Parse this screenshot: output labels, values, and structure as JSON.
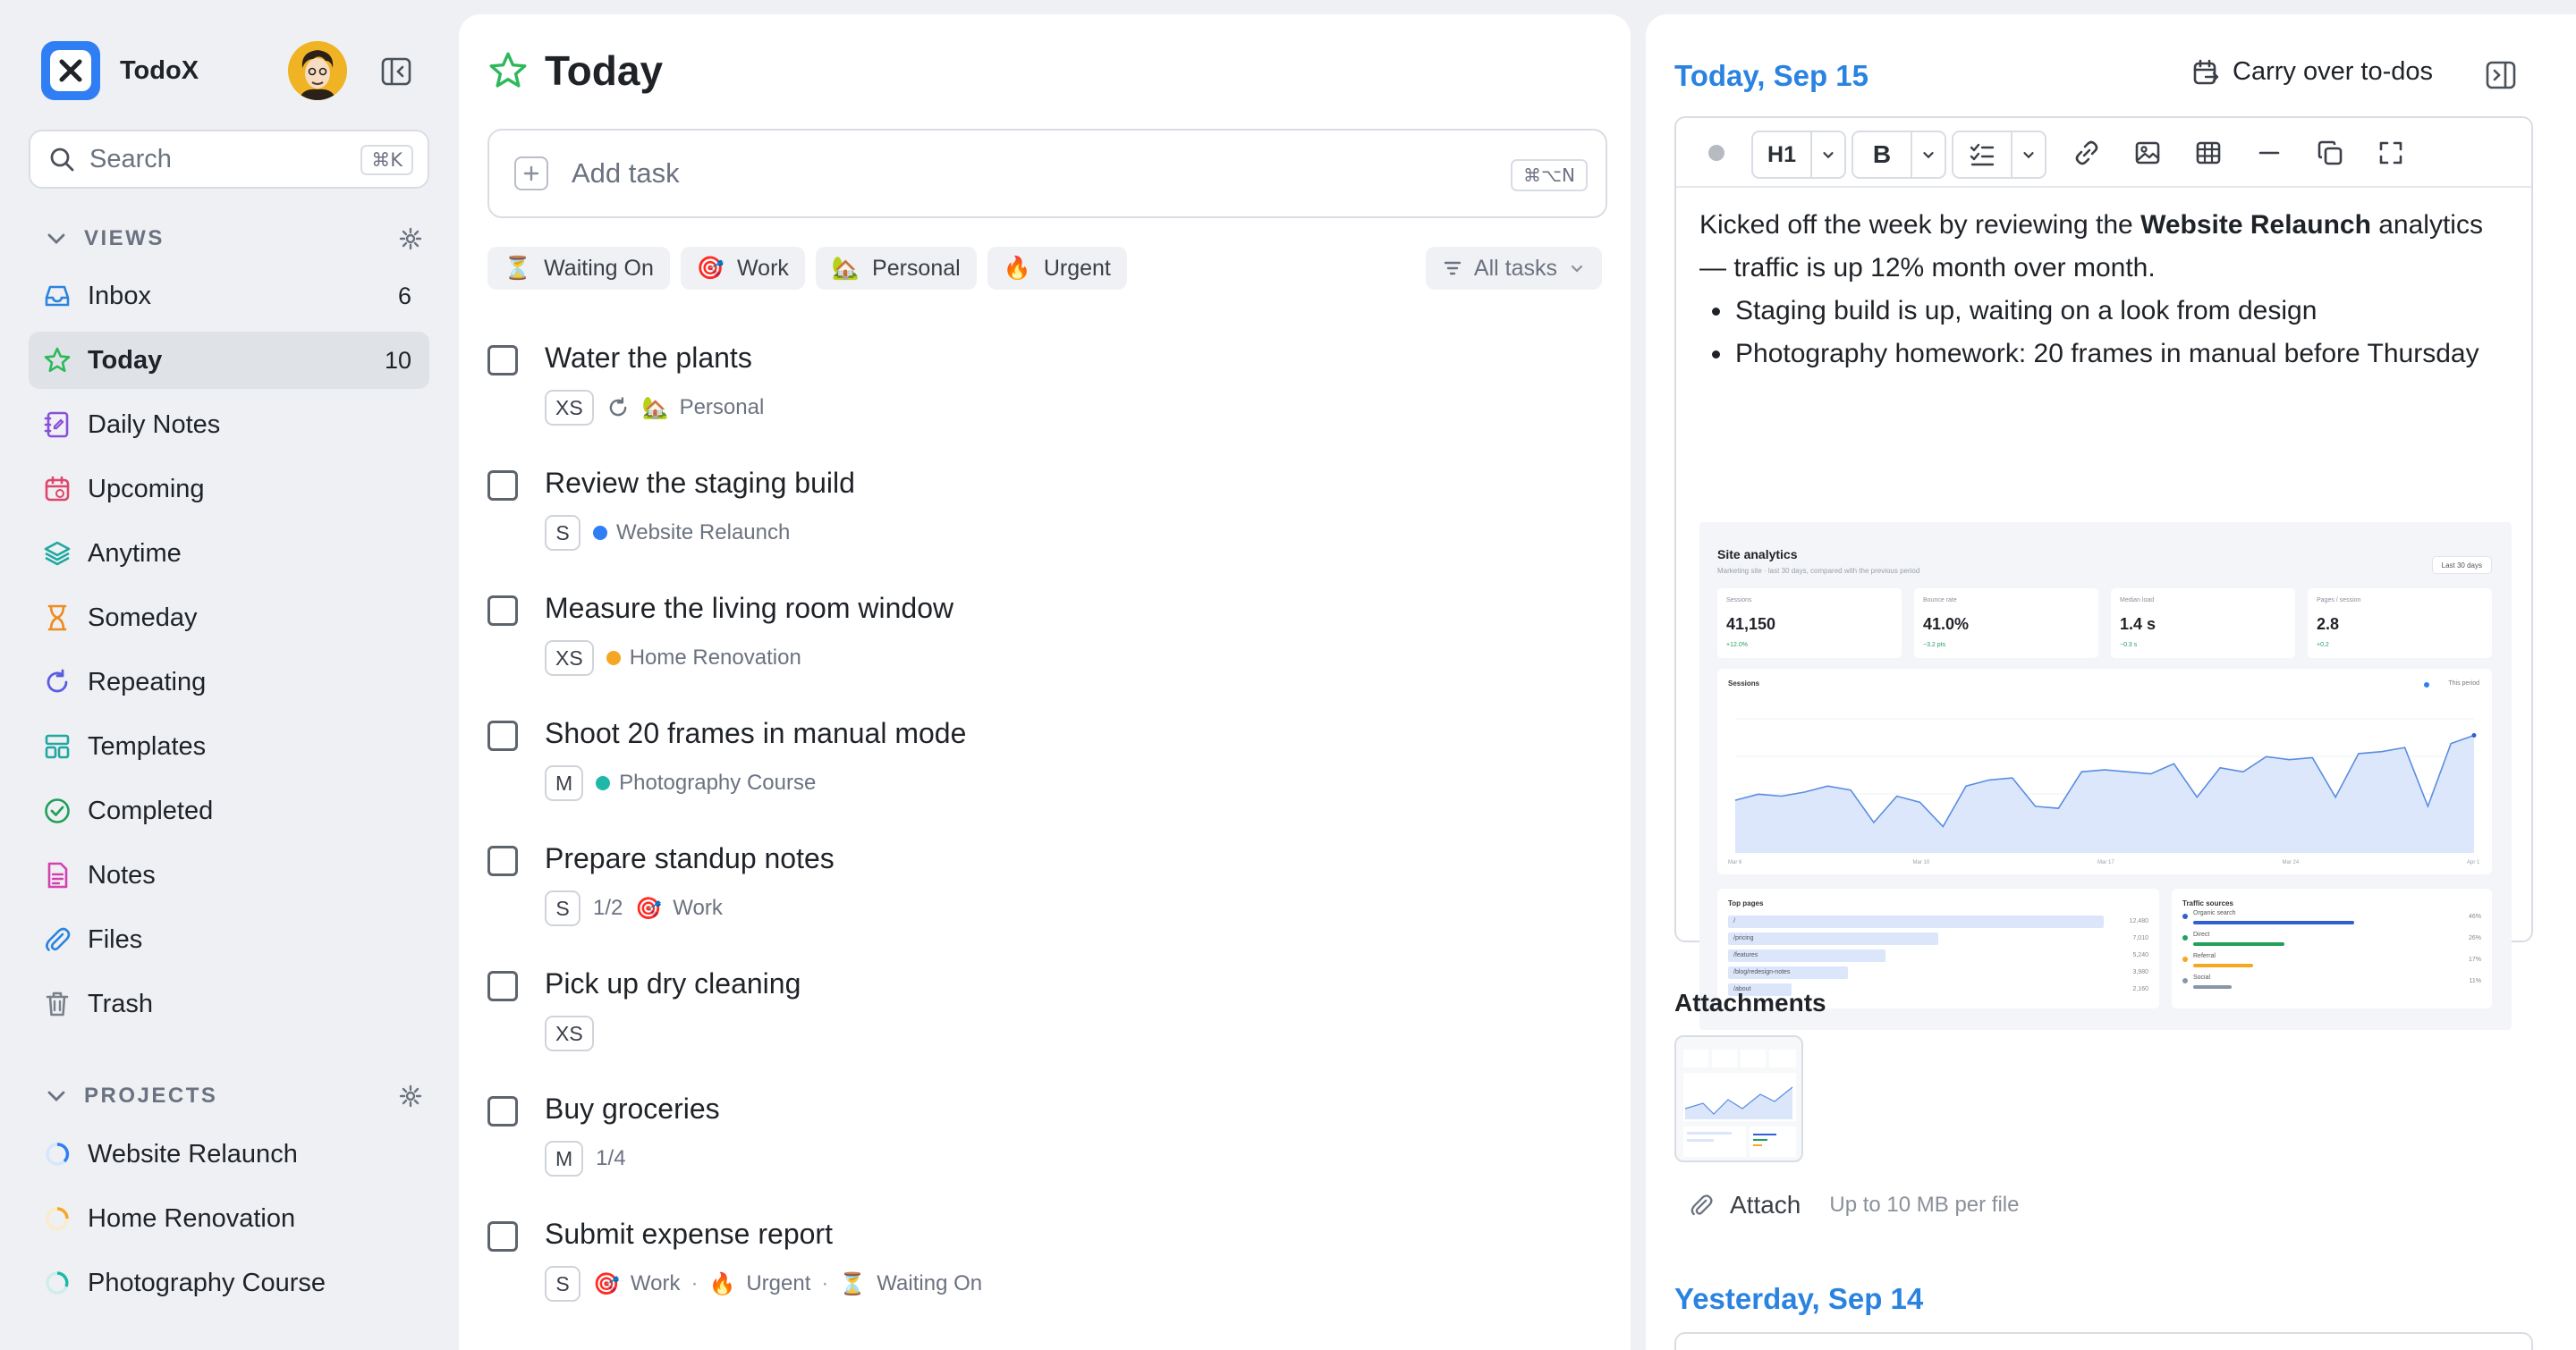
{
  "app": {
    "name": "TodoX",
    "search_label": "Search",
    "search_shortcut": "⌘K"
  },
  "colors": {
    "accent": "#2b83e0",
    "logo": "#2f7ef3",
    "active_nav": "#dfe2e7",
    "green_star": "#2eb85c"
  },
  "sidebar": {
    "views_title": "VIEWS",
    "views": [
      {
        "label": "Inbox",
        "count": "6",
        "icon": "inbox-icon"
      },
      {
        "label": "Today",
        "count": "10",
        "icon": "star-icon",
        "active": true
      },
      {
        "label": "Daily Notes",
        "count": "",
        "icon": "notebook-icon"
      },
      {
        "label": "Upcoming",
        "count": "",
        "icon": "calendar-icon"
      },
      {
        "label": "Anytime",
        "count": "",
        "icon": "layers-icon"
      },
      {
        "label": "Someday",
        "count": "",
        "icon": "hourglass-icon"
      },
      {
        "label": "Repeating",
        "count": "",
        "icon": "repeat-icon"
      },
      {
        "label": "Templates",
        "count": "",
        "icon": "template-icon"
      },
      {
        "label": "Completed",
        "count": "",
        "icon": "check-circle-icon"
      },
      {
        "label": "Notes",
        "count": "",
        "icon": "note-icon"
      },
      {
        "label": "Files",
        "count": "",
        "icon": "paperclip-icon"
      },
      {
        "label": "Trash",
        "count": "",
        "icon": "trash-icon"
      }
    ],
    "projects_title": "PROJECTS",
    "projects": [
      {
        "label": "Website Relaunch",
        "color": "#2f7ef3"
      },
      {
        "label": "Home Renovation",
        "color": "#f5a623"
      },
      {
        "label": "Photography Course",
        "color": "#1fb8a8"
      }
    ]
  },
  "main": {
    "title": "Today",
    "add_task_placeholder": "Add task",
    "add_task_shortcut": "⌘⌥N",
    "filters": [
      {
        "emoji": "⏳",
        "label": "Waiting On"
      },
      {
        "emoji": "🎯",
        "label": "Work"
      },
      {
        "emoji": "🏡",
        "label": "Personal"
      },
      {
        "emoji": "🔥",
        "label": "Urgent"
      }
    ],
    "all_tasks_label": "All tasks",
    "tasks": [
      {
        "title": "Water the plants",
        "size": "XS",
        "repeat": true,
        "tags": [
          {
            "emoji": "🏡",
            "label": "Personal"
          }
        ]
      },
      {
        "title": "Review the staging build",
        "size": "S",
        "project": {
          "label": "Website Relaunch",
          "color": "#2f7ef3"
        }
      },
      {
        "title": "Measure the living room window",
        "size": "XS",
        "project": {
          "label": "Home Renovation",
          "color": "#f5a623"
        }
      },
      {
        "title": "Shoot 20 frames in manual mode",
        "size": "M",
        "project": {
          "label": "Photography Course",
          "color": "#1fb8a8"
        }
      },
      {
        "title": "Prepare standup notes",
        "size": "S",
        "subtasks": "1/2",
        "tags": [
          {
            "emoji": "🎯",
            "label": "Work"
          }
        ]
      },
      {
        "title": "Pick up dry cleaning",
        "size": "XS"
      },
      {
        "title": "Buy groceries",
        "size": "M",
        "subtasks": "1/4"
      },
      {
        "title": "Submit expense report",
        "size": "S",
        "tags": [
          {
            "emoji": "🎯",
            "label": "Work"
          },
          {
            "emoji": "🔥",
            "label": "Urgent"
          },
          {
            "emoji": "⏳",
            "label": "Waiting On"
          }
        ]
      }
    ]
  },
  "daily": {
    "today_header": "Today, Sep 15",
    "carry_over_label": "Carry over to-dos",
    "toolbar": {
      "heading": "H1",
      "bold": "B"
    },
    "note": {
      "intro_before": "Kicked off the week by reviewing the ",
      "intro_bold": "Website Relaunch",
      "intro_after": " analytics — traffic is up 12% month over month.",
      "bullets": [
        "Staging build is up, waiting on a look from design",
        "Photography homework: 20 frames in manual before Thursday"
      ]
    },
    "embed": {
      "title": "Site analytics",
      "subtitle": "Marketing site · last 30 days, compared with the previous period",
      "range": "Last 30 days",
      "stats": [
        {
          "label": "Sessions",
          "value": "41,150",
          "delta": "+12.0%"
        },
        {
          "label": "Bounce rate",
          "value": "41.0%",
          "delta": "−3.2 pts"
        },
        {
          "label": "Median load",
          "value": "1.4 s",
          "delta": "−0.3 s"
        },
        {
          "label": "Pages / session",
          "value": "2.8",
          "delta": "+0.2"
        }
      ],
      "sessions_title": "Sessions",
      "sessions_legend": "This period",
      "sessions_series": [
        52,
        58,
        56,
        60,
        66,
        62,
        30,
        56,
        50,
        26,
        66,
        72,
        74,
        46,
        44,
        80,
        82,
        80,
        78,
        88,
        55,
        84,
        80,
        95,
        92,
        94,
        55,
        98,
        100,
        104,
        46,
        108,
        116
      ],
      "sessions_ylim": [
        0,
        150
      ],
      "x_ticks": [
        "Mar 6",
        "Mar 10",
        "Mar 17",
        "Mar 24",
        "Apr 1"
      ],
      "top_pages_title": "Top pages",
      "top_pages": [
        {
          "label": "/",
          "value": "12,480",
          "share": 1.0
        },
        {
          "label": "/pricing",
          "value": "7,010",
          "share": 0.56
        },
        {
          "label": "/features",
          "value": "5,240",
          "share": 0.42
        },
        {
          "label": "/blog/redesign-notes",
          "value": "3,980",
          "share": 0.32
        },
        {
          "label": "/about",
          "value": "2,160",
          "share": 0.17
        }
      ],
      "traffic_title": "Traffic sources",
      "traffic": [
        {
          "label": "Organic search",
          "value": "46%",
          "color": "#2f5fd1",
          "share": 0.46
        },
        {
          "label": "Direct",
          "value": "26%",
          "color": "#21a05a",
          "share": 0.26
        },
        {
          "label": "Referral",
          "value": "17%",
          "color": "#f5a623",
          "share": 0.17
        },
        {
          "label": "Social",
          "value": "11%",
          "color": "#8a96a8",
          "share": 0.11
        }
      ]
    },
    "attachments_title": "Attachments",
    "attach_label": "Attach",
    "attach_note": "Up to 10 MB per file",
    "yesterday_header": "Yesterday, Sep 14"
  }
}
